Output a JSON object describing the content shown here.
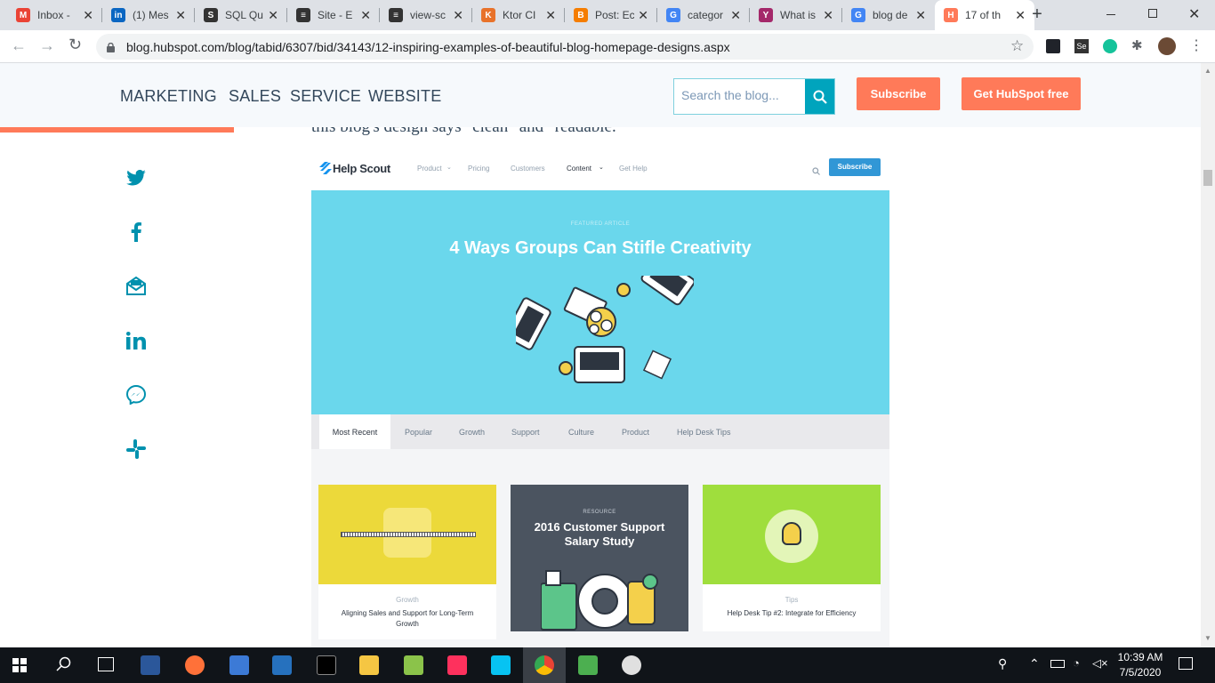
{
  "browser": {
    "tabs": [
      {
        "title": "Inbox -",
        "icon": "gmail-icon",
        "color": "#ea4335",
        "glyph": "M"
      },
      {
        "title": "(1) Mes",
        "icon": "linkedin-icon",
        "color": "#0a66c2",
        "glyph": "in"
      },
      {
        "title": "SQL Qu",
        "icon": "sql-icon",
        "color": "#333333",
        "glyph": "S"
      },
      {
        "title": "Site - E",
        "icon": "site-icon",
        "color": "#333333",
        "glyph": "≡"
      },
      {
        "title": "view-sc",
        "icon": "view-source-icon",
        "color": "#333333",
        "glyph": "≡"
      },
      {
        "title": "Ktor CI",
        "icon": "ktor-icon",
        "color": "#e8722a",
        "glyph": "K"
      },
      {
        "title": "Post: Ec",
        "icon": "blogger-icon",
        "color": "#f57d00",
        "glyph": "B"
      },
      {
        "title": "categor",
        "icon": "google-icon",
        "color": "#4285f4",
        "glyph": "G"
      },
      {
        "title": "What is",
        "icon": "yoast-icon",
        "color": "#a4286a",
        "glyph": "Y"
      },
      {
        "title": "blog de",
        "icon": "google-icon",
        "color": "#4285f4",
        "glyph": "G"
      },
      {
        "title": "17 of th",
        "icon": "hubspot-icon",
        "color": "#ff7a59",
        "glyph": "H"
      }
    ],
    "url": "blog.hubspot.com/blog/tabid/6307/bid/34143/12-inspiring-examples-of-beautiful-blog-homepage-designs.aspx"
  },
  "nav": {
    "links": [
      "MARKETING",
      "SALES",
      "SERVICE",
      "WEBSITE"
    ],
    "search_placeholder": "Search the blog...",
    "subscribe": "Subscribe",
    "get_hubspot": "Get HubSpot free"
  },
  "article": {
    "intro_fragment": "this blog's design says \"clean\" and \"readable.\""
  },
  "social": [
    "twitter-icon",
    "facebook-icon",
    "email-icon",
    "linkedin-icon",
    "messenger-icon",
    "slack-icon"
  ],
  "helpscout": {
    "logo": "Help Scout",
    "menu": [
      "Product",
      "Pricing",
      "Customers",
      "Content",
      "Get Help"
    ],
    "subscribe": "Subscribe",
    "featured_label": "FEATURED ARTICLE",
    "featured_title": "4 Ways Groups Can Stifle Creativity",
    "tabs": [
      "Most Recent",
      "Popular",
      "Growth",
      "Support",
      "Culture",
      "Product",
      "Help Desk Tips"
    ],
    "cards": [
      {
        "category": "Growth",
        "title": "Aligning Sales and Support for Long-Term Growth",
        "color": "#ecd93a"
      },
      {
        "resource": "RESOURCE",
        "title": "2016 Customer Support Salary Study",
        "color": "#4b5460"
      },
      {
        "category": "Tips",
        "title": "Help Desk Tip #2: Integrate for Efficiency",
        "color": "#9fde3d"
      }
    ]
  },
  "taskbar": {
    "time": "10:39 AM",
    "date": "7/5/2020"
  },
  "colors": {
    "hubspot_orange": "#ff7a59",
    "hubspot_teal": "#00a4bd",
    "helpscout_blue": "#3197d6",
    "hero_bg": "#6ad7ec"
  }
}
